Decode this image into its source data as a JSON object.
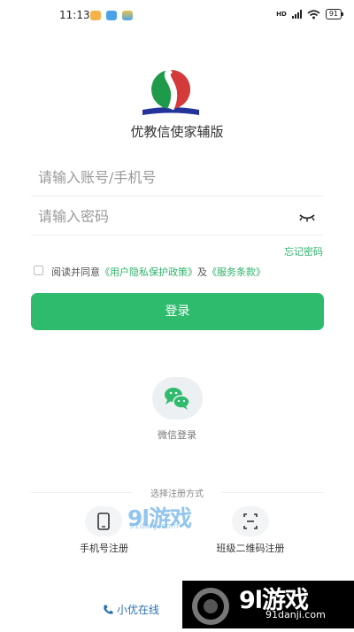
{
  "status_bar": {
    "time": "11:13",
    "network": "HD",
    "battery": "91"
  },
  "app": {
    "title": "优教信使家辅版"
  },
  "login_form": {
    "account_placeholder": "请输入账号/手机号",
    "password_placeholder": "请输入密码",
    "forgot_password": "忘记密码",
    "agreement_prefix": "阅读并同意",
    "privacy_policy": "《用户隐私保护政策》",
    "agreement_and": "及",
    "terms": "《服务条款》",
    "login_button": "登录"
  },
  "wechat": {
    "label": "微信登录"
  },
  "register": {
    "title": "选择注册方式",
    "phone": "手机号注册",
    "class_qr": "班级二维码注册"
  },
  "service": {
    "label": "小优在线"
  },
  "watermark": {
    "brand": "9l游戏",
    "site": "91danji.com"
  },
  "colors": {
    "accent": "#2fbb6e",
    "link": "#2db36a"
  }
}
